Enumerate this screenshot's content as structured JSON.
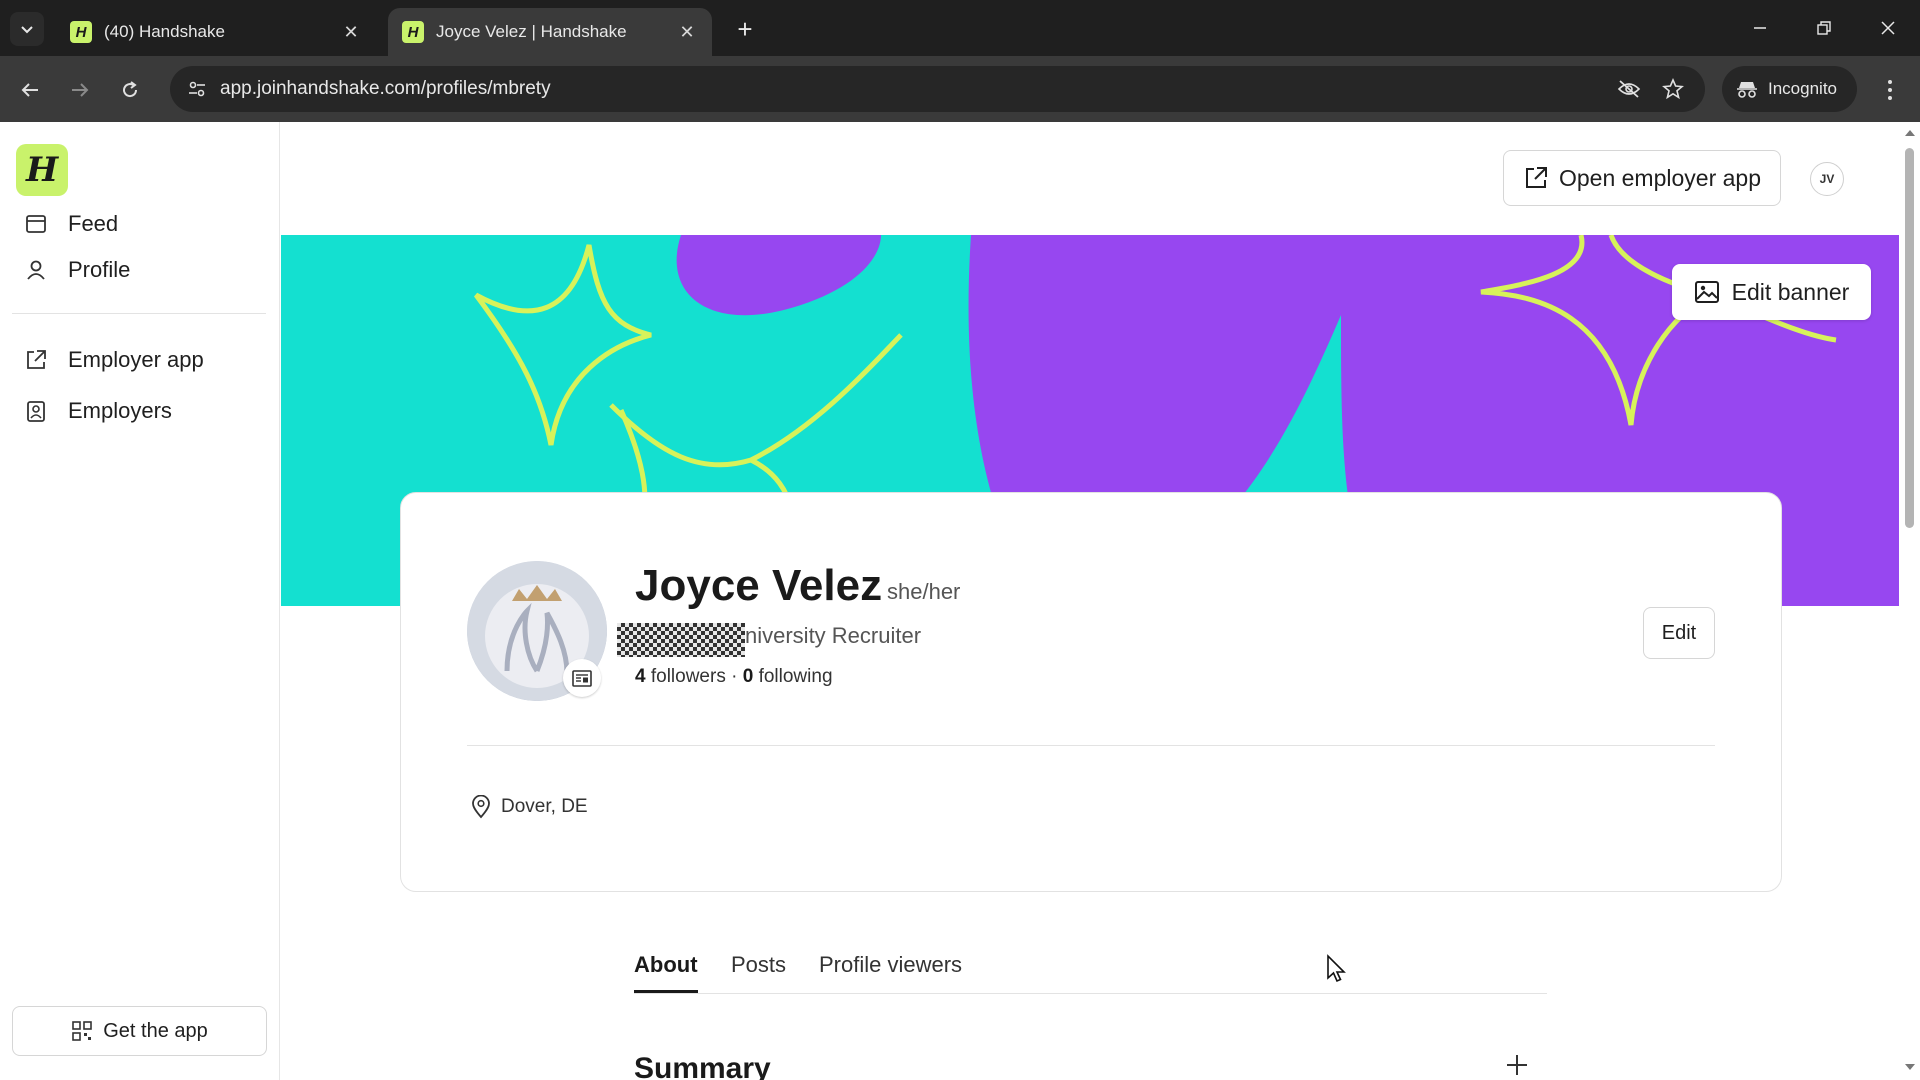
{
  "browser": {
    "tabs": [
      {
        "title": "(40) Handshake",
        "active": false
      },
      {
        "title": "Joyce Velez | Handshake",
        "active": true
      }
    ],
    "url": "app.joinhandshake.com/profiles/mbrety",
    "incognito_label": "Incognito",
    "favicon_letter": "H"
  },
  "sidebar": {
    "logo_letter": "H",
    "items": [
      {
        "label": "Feed",
        "icon": "feed-icon"
      },
      {
        "label": "Profile",
        "icon": "user-icon"
      },
      {
        "label": "Employer app",
        "icon": "external-link-icon"
      },
      {
        "label": "Employers",
        "icon": "badge-icon"
      }
    ],
    "get_app_label": "Get the app"
  },
  "header": {
    "open_employer_label": "Open employer app",
    "avatar_initials": "JV"
  },
  "banner": {
    "edit_label": "Edit banner",
    "colors": {
      "teal": "#14e0d0",
      "purple": "#9747f0",
      "lime": "#d7f25a"
    }
  },
  "profile": {
    "name": "Joyce Velez",
    "pronouns": "she/her",
    "title_visible": "niversity Recruiter",
    "followers_count": "4",
    "followers_label": " followers · ",
    "following_count": "0",
    "following_label": " following",
    "edit_label": "Edit",
    "location": "Dover, DE"
  },
  "tabs": [
    "About",
    "Posts",
    "Profile viewers"
  ],
  "active_tab": "About",
  "section": {
    "title": "Summary"
  }
}
